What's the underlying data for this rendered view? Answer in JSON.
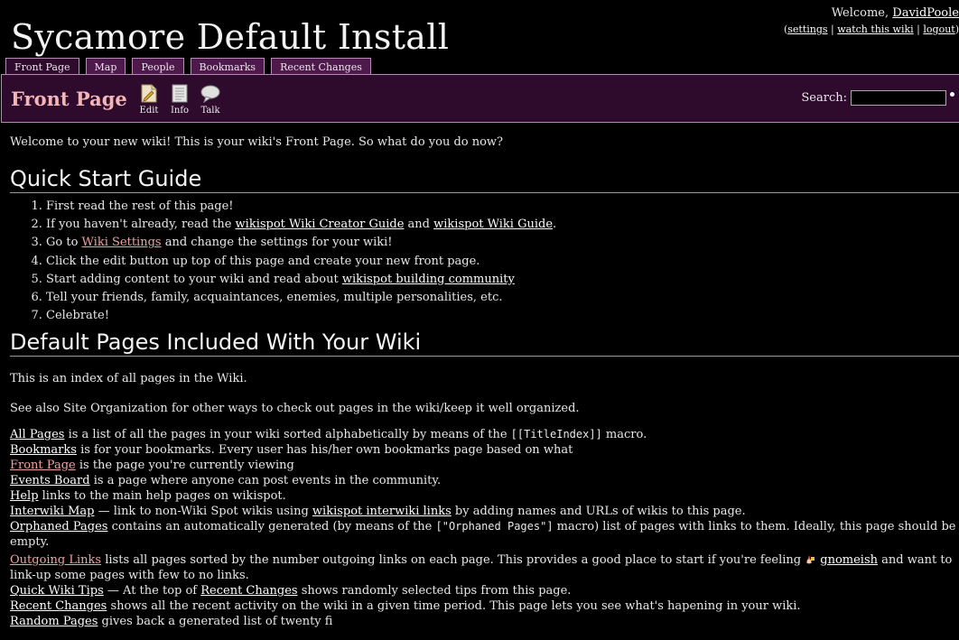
{
  "site": {
    "title": "Sycamore Default Install"
  },
  "user": {
    "welcome": "Welcome,",
    "name": "DavidPoole",
    "settings": "settings",
    "watch": "watch this wiki",
    "logout": "logout",
    "open_paren": "(",
    "sep": "|",
    "close_paren": ")"
  },
  "tabs": [
    {
      "label": "Front Page",
      "active": true
    },
    {
      "label": "Map"
    },
    {
      "label": "People"
    },
    {
      "label": "Bookmarks"
    },
    {
      "label": "Recent Changes"
    }
  ],
  "titlebar": {
    "title": "Front Page",
    "actions": [
      {
        "label": "Edit",
        "icon": "edit-icon"
      },
      {
        "label": "Info",
        "icon": "info-icon"
      },
      {
        "label": "Talk",
        "icon": "talk-icon"
      }
    ],
    "search_label": "Search:",
    "search_value": ""
  },
  "content": {
    "intro": "Welcome to your new wiki! This is your wiki's Front Page. So what do you do now?",
    "quick_title": "Quick Start Guide",
    "quick": {
      "i1": "First read the rest of this page!",
      "i2_a": "If you haven't already, read the ",
      "i2_l1": "wikispot Wiki Creator Guide",
      "i2_b": " and ",
      "i2_l2": "wikispot Wiki Guide",
      "i2_c": ".",
      "i3_a": "Go to ",
      "i3_l": "Wiki Settings",
      "i3_b": " and change the settings for your wiki!",
      "i4": "Click the edit button up top of this page and create your new front page.",
      "i5_a": "Start adding content to your wiki and read about ",
      "i5_l": "wikispot building community",
      "i6": "Tell your friends, family, acquaintances, enemies, multiple personalities, etc.",
      "i7": "Celebrate!"
    },
    "default_title": "Default Pages Included With Your Wiki",
    "index_text": "This is an index of all pages in the Wiki.",
    "see_also": "See also Site Organization for other ways to check out pages in the wiki/keep it well organized.",
    "pages": {
      "all_l": "All Pages",
      "all_a": " is a list of all the pages in your wiki sorted alphabetically by means of the ",
      "all_code": "[[TitleIndex]]",
      "all_b": " macro.",
      "bm_l": "Bookmarks",
      "bm_a": " is for your bookmarks. Every user has his/her own bookmarks page based on what",
      "fp_l": "Front Page",
      "fp_a": " is the page you're currently viewing",
      "ev_l": "Events Board",
      "ev_a": " is a page where anyone can post events in the community.",
      "help_l": "Help",
      "help_a": " links to the main help pages on wikispot.",
      "iw_l": "Interwiki Map",
      "iw_a": " — link to non-Wiki Spot wikis using ",
      "iw_l2": "wikispot interwiki links",
      "iw_b": " by adding names and URLs of wikis to this page.",
      "orph_l": "Orphaned Pages",
      "orph_a": " contains an automatically generated (by means of the ",
      "orph_code": "[\"Orphaned Pages\"]",
      "orph_b": " macro) list of pages with links to them. Ideally, this page should be empty.",
      "out_l": "Outgoing Links",
      "out_a": " lists all pages sorted by the number outgoing links on each page. This provides a good place to start if you're feeling ",
      "out_l2": "gnomeish",
      "out_b": " and want to link-up some pages with few to no links.",
      "qwt_l": "Quick Wiki Tips",
      "qwt_a": " — At the top of ",
      "qwt_l2": "Recent Changes",
      "qwt_b": " shows randomly selected tips from this page.",
      "rc_l": "Recent Changes",
      "rc_a": " shows all the recent activity on the wiki in a given time period. This page lets you see what's hapening in your wiki.",
      "rp_l": "Random Pages",
      "rp_a": " gives back a generated list of twenty fi"
    }
  }
}
